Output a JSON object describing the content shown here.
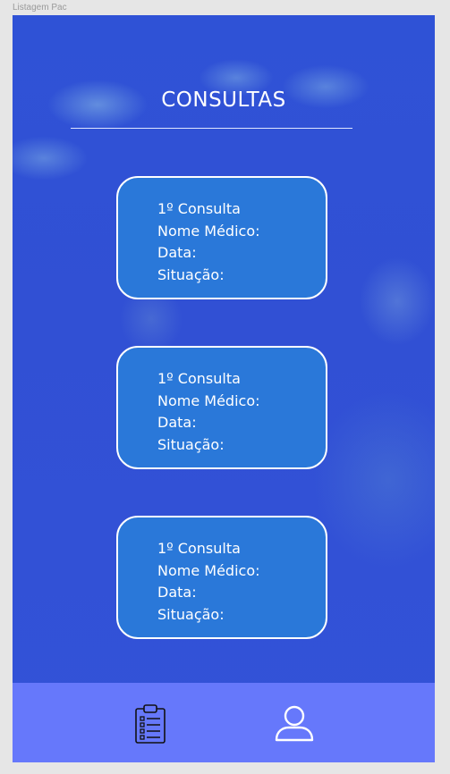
{
  "window": {
    "frame_label": "Listagem Pac"
  },
  "header": {
    "title": "CONSULTAS"
  },
  "consultas": [
    {
      "line1": "1º  Consulta",
      "line2": "Nome Médico:",
      "line3": "Data:",
      "line4": "Situação:"
    },
    {
      "line1": "1º  Consulta",
      "line2": "Nome Médico:",
      "line3": "Data:",
      "line4": "Situação:"
    },
    {
      "line1": "1º  Consulta",
      "line2": "Nome Médico:",
      "line3": "Data:",
      "line4": "Situação:"
    }
  ],
  "bottom_nav": {
    "items": [
      {
        "icon": "clipboard-list-icon"
      },
      {
        "icon": "user-profile-icon"
      }
    ]
  },
  "colors": {
    "background": "#3150d4",
    "card_fill": "#2a78d9",
    "card_border": "#ffffff",
    "nav_bar": "#6678fb"
  }
}
